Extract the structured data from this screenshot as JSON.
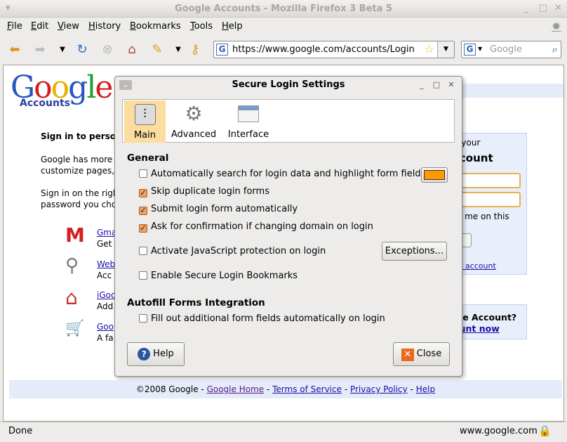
{
  "window": {
    "title": "Google Accounts - Mozilla Firefox 3 Beta 5"
  },
  "menu": [
    "File",
    "Edit",
    "View",
    "History",
    "Bookmarks",
    "Tools",
    "Help"
  ],
  "toolbar": {
    "url": "https://www.google.com/accounts/Login",
    "search_placeholder": "Google"
  },
  "page": {
    "logo_text": "Google",
    "logo_sub": "Accounts",
    "heading": "Sign in to persor",
    "para1": [
      "Google has more t",
      "customize pages,"
    ],
    "para2": [
      "Sign in on the righ",
      "password you cho"
    ],
    "services": [
      {
        "title": "Gma",
        "desc": "Get"
      },
      {
        "title": "Web",
        "desc": "Acc"
      },
      {
        "title": "iGoo",
        "desc": "Add"
      },
      {
        "title": "Goo",
        "desc": "A fa"
      }
    ],
    "signin": {
      "line1": "n your",
      "line2": "ccount",
      "remember": [
        "er me on this",
        "r."
      ],
      "cant_access": "ny account"
    },
    "create": {
      "q": "gle Account?",
      "link": "ount now"
    },
    "footer": {
      "copy": "©2008 Google - ",
      "home": "Google Home",
      "sep1": " - ",
      "tos": "Terms of Service",
      "sep2": " - ",
      "privacy": "Privacy Policy",
      "sep3": " - ",
      "help": "Help"
    }
  },
  "status": {
    "left": "Done",
    "right": "www.google.com"
  },
  "dialog": {
    "title": "Secure Login Settings",
    "tabs": [
      {
        "label": "Main"
      },
      {
        "label": "Advanced"
      },
      {
        "label": "Interface"
      }
    ],
    "general": "General",
    "options": [
      {
        "label": "Automatically search for login data and highlight form fields",
        "checked": false
      },
      {
        "label": "Skip duplicate login forms",
        "checked": true
      },
      {
        "label": "Submit login form automatically",
        "checked": true
      },
      {
        "label": "Ask for confirmation if changing domain on login",
        "checked": true
      },
      {
        "label": "Activate JavaScript protection on login",
        "checked": false
      },
      {
        "label": "Enable Secure Login Bookmarks",
        "checked": false
      }
    ],
    "highlight_color": "#ff9900",
    "exceptions": "Exceptions...",
    "autofill": "Autofill Forms Integration",
    "autofill_option": {
      "label": "Fill out additional form fields automatically on login",
      "checked": false
    },
    "help": "Help",
    "close": "Close"
  }
}
